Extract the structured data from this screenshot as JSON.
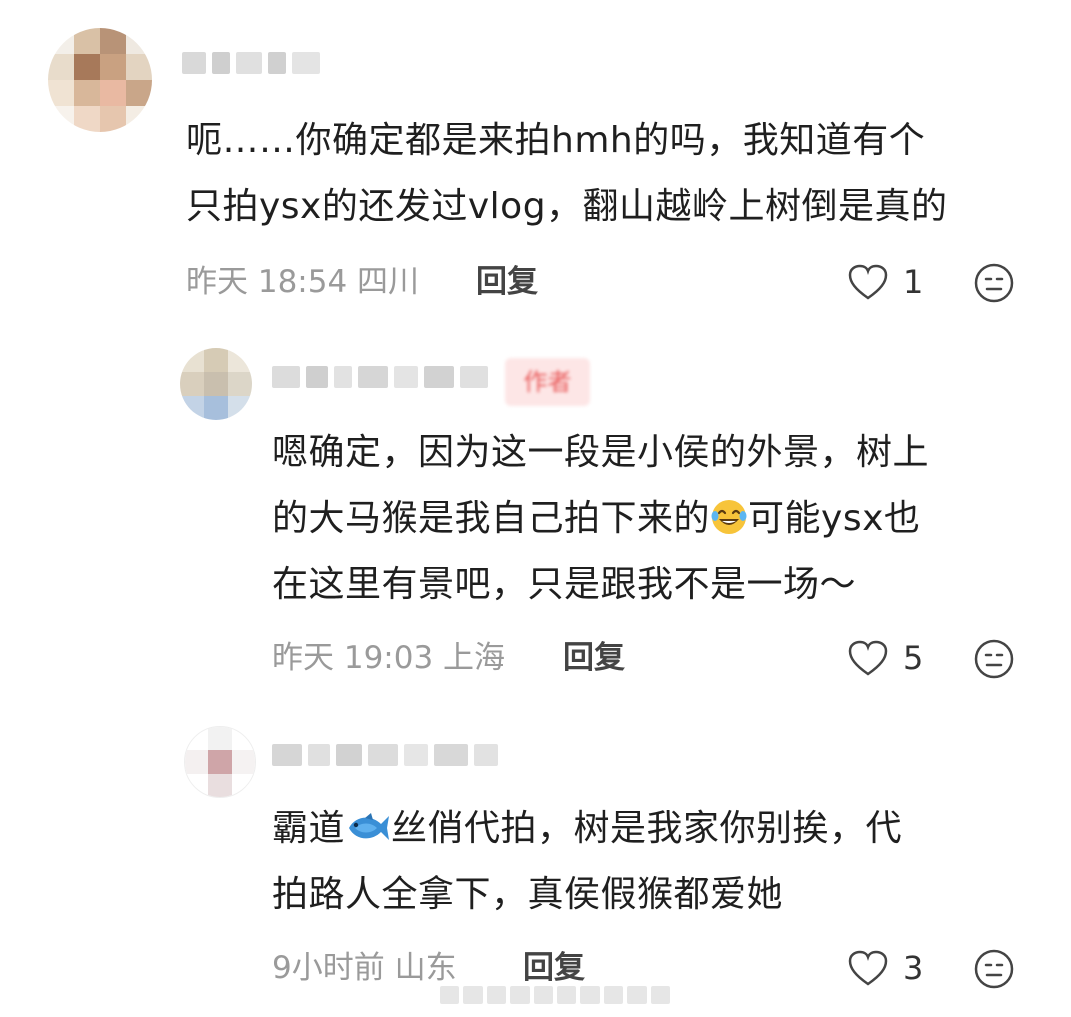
{
  "comments": [
    {
      "text": "呃……你确定都是来拍hmh的吗，我知道有个只拍ysx的还发过vlog，翻山越岭上树倒是真的",
      "line1": "呃……你确定都是来拍hmh的吗，我知道有个",
      "line2": "只拍ysx的还发过vlog，翻山越岭上树倒是真的",
      "meta": "昨天 18:54 四川",
      "reply_label": "回复",
      "likes": "1"
    },
    {
      "author_tag": "作者",
      "line1": "嗯确定，因为这一段是小侯的外景，树上",
      "line2a": "的大马猴是我自己拍下来的",
      "line2_emoji": "laughing-tears-emoji",
      "line2b": "可能ysx也",
      "line3": "在这里有景吧，只是跟我不是一场～",
      "meta": "昨天 19:03 上海",
      "reply_label": "回复",
      "likes": "5"
    },
    {
      "line1a": "霸道",
      "line1_emoji": "fish-emoji",
      "line1b": "丝俏代拍，树是我家你别挨，代",
      "line2": "拍路人全拿下，真侯假猴都爱她",
      "meta": "9小时前 山东",
      "reply_label": "回复",
      "likes": "3"
    }
  ],
  "icons": {
    "like": "heart-outline-icon",
    "dislike": "neutral-face-icon"
  },
  "colors": {
    "text": "#1f1f1f",
    "meta": "#9a9a9a",
    "author_tag_bg": "#fde6e6",
    "author_tag_fg": "#e95b5b"
  }
}
